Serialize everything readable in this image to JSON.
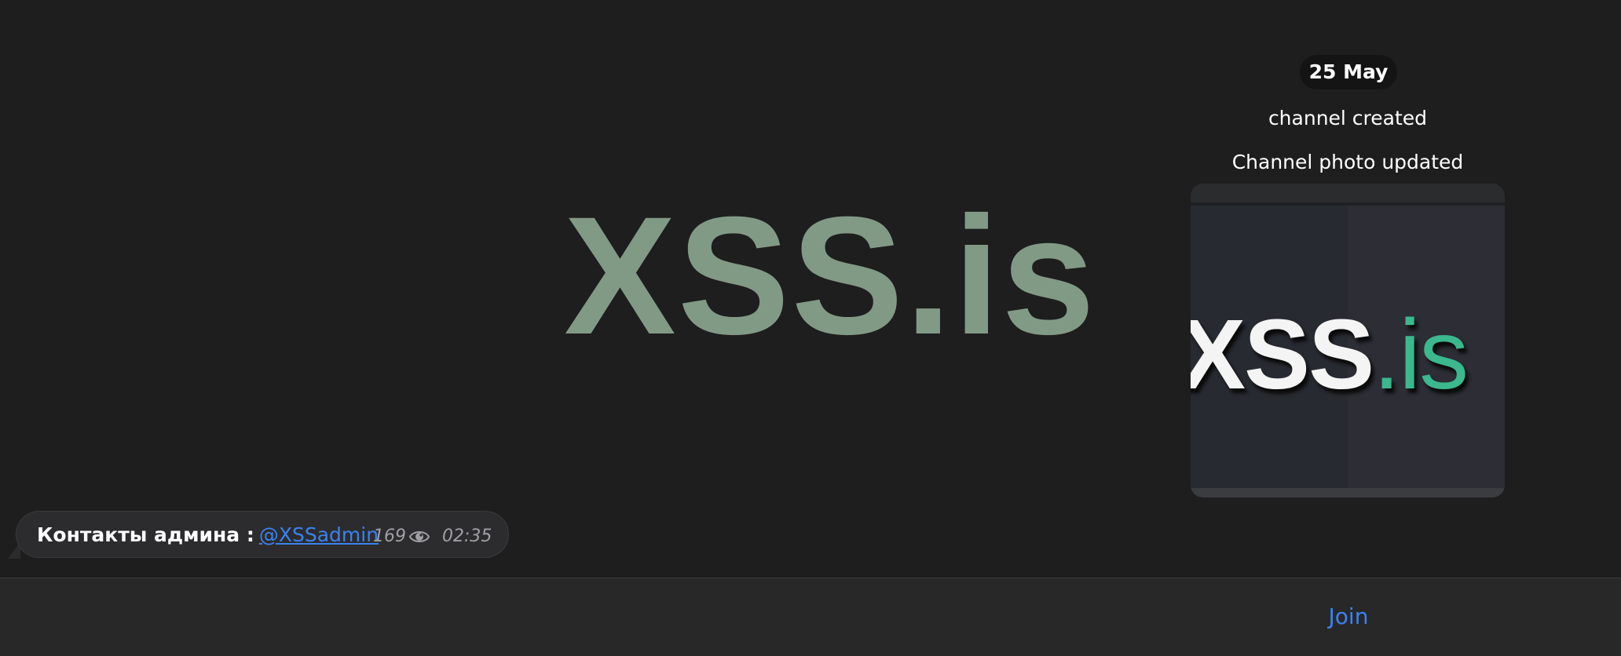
{
  "wallpaper": {
    "logo_text": "XSS.is"
  },
  "feed": {
    "date_label": "25 May",
    "service_messages": [
      "channel created",
      "Channel photo updated"
    ],
    "channel_photo": {
      "main_text": "XSS",
      "accent_text": ".is",
      "accent_color": "#3bb88d"
    },
    "message": {
      "text": "Контакты админа :",
      "link": "@XSSadmin",
      "views": "169",
      "view_icon": "eye-icon",
      "time": "02:35"
    }
  },
  "bottom_bar": {
    "join_label": "Join"
  },
  "colors": {
    "background": "#1e1e1e",
    "bubble": "#2c2c2e",
    "link": "#3b82f0",
    "wallpaper_logo": "#819a85"
  }
}
